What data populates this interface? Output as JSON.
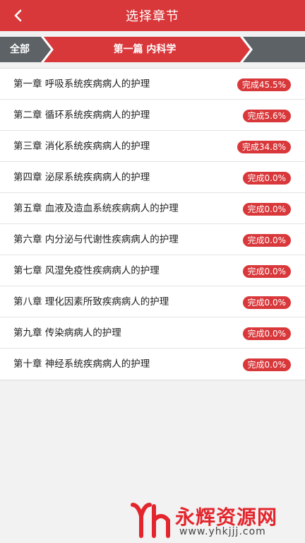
{
  "header": {
    "title": "选择章节",
    "back_icon": "chevron-left-icon"
  },
  "breadcrumb": {
    "root": "全部",
    "current": "第一篇 内科学"
  },
  "chapters": [
    {
      "label": "第一章 呼吸系统疾病病人的护理",
      "progress": "完成45.5%"
    },
    {
      "label": "第二章 循环系统疾病病人的护理",
      "progress": "完成5.6%"
    },
    {
      "label": "第三章 消化系统疾病病人的护理",
      "progress": "完成34.8%"
    },
    {
      "label": "第四章 泌尿系统疾病病人的护理",
      "progress": "完成0.0%"
    },
    {
      "label": "第五章 血液及造血系统疾病病人的护理",
      "progress": "完成0.0%"
    },
    {
      "label": "第六章 内分泌与代谢性疾病病人的护理",
      "progress": "完成0.0%"
    },
    {
      "label": "第七章 风湿免疫性疾病病人的护理",
      "progress": "完成0.0%"
    },
    {
      "label": "第八章 理化因素所致疾病病人的护理",
      "progress": "完成0.0%"
    },
    {
      "label": "第九章 传染病病人的护理",
      "progress": "完成0.0%"
    },
    {
      "label": "第十章 神经系统疾病病人的护理",
      "progress": "完成0.0%"
    }
  ],
  "watermark": {
    "name": "永辉资源网",
    "url": "www.yhkjjj.com"
  },
  "colors": {
    "accent": "#d9383b",
    "crumb_bg": "#5d6266",
    "page_bg": "#f2f2f2"
  }
}
